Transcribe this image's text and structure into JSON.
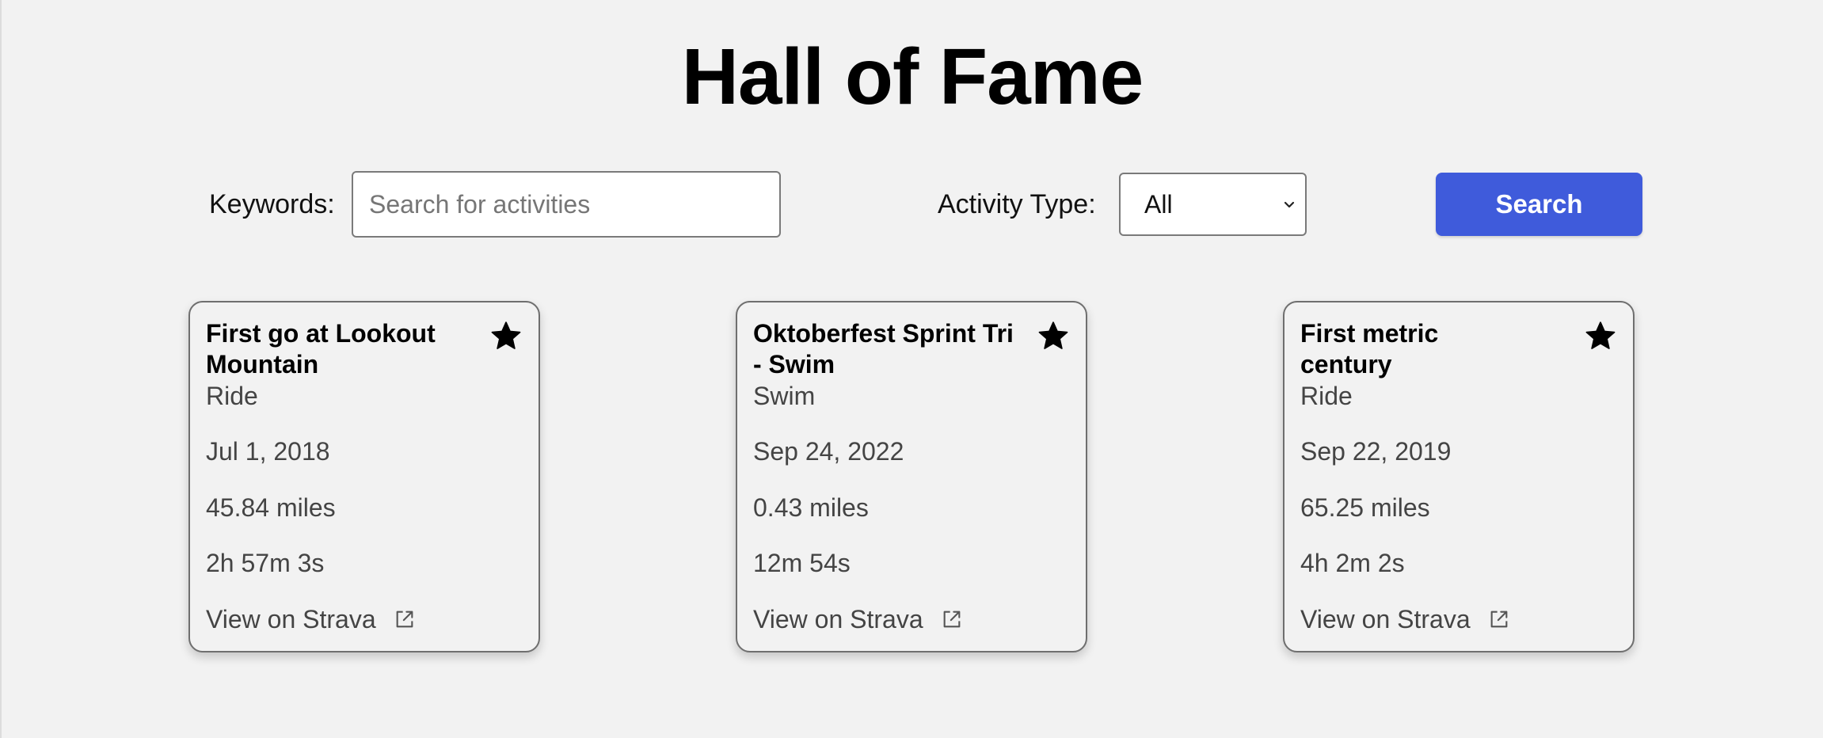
{
  "page": {
    "title": "Hall of Fame"
  },
  "filters": {
    "keywords_label": "Keywords:",
    "keywords_placeholder": "Search for activities",
    "keywords_value": "",
    "activity_type_label": "Activity Type:",
    "activity_type_selected": "All",
    "search_label": "Search"
  },
  "cards": [
    {
      "title": "First go at Lookout Mountain",
      "type": "Ride",
      "date": "Jul 1, 2018",
      "distance": "45.84 miles",
      "duration": "2h 57m 3s",
      "link_label": "View on Strava",
      "icon": "star-icon"
    },
    {
      "title": "Oktoberfest Sprint Tri - Swim",
      "type": "Swim",
      "date": "Sep 24, 2022",
      "distance": "0.43 miles",
      "duration": "12m 54s",
      "link_label": "View on Strava",
      "icon": "star-icon"
    },
    {
      "title": "First metric century",
      "type": "Ride",
      "date": "Sep 22, 2019",
      "distance": "65.25 miles",
      "duration": "4h 2m 2s",
      "link_label": "View on Strava",
      "icon": "star-icon"
    }
  ],
  "colors": {
    "background": "#f2f2f2",
    "accent": "#3f5bdb",
    "card_border": "#6f6f6f",
    "secondary_text": "#444444"
  }
}
